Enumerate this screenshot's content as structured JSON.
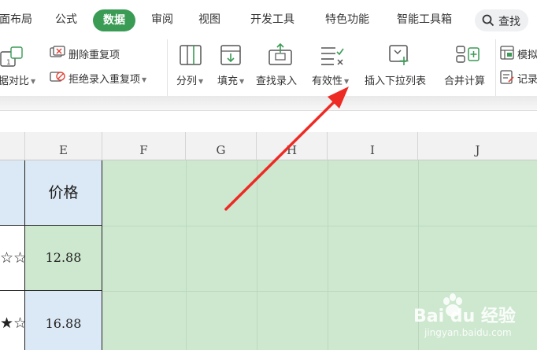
{
  "menu": {
    "items": [
      "面布局",
      "公式",
      "数据",
      "审阅",
      "视图",
      "开发工具",
      "特色功能",
      "智能工具箱"
    ],
    "active": "数据",
    "search_label": "查找"
  },
  "ribbon": {
    "compare_label": "据对比",
    "remove_dup_label": "删除重复项",
    "reject_dup_label": "拒绝录入重复项",
    "split_label": "分列",
    "fill_label": "填充",
    "lookup_label": "查找录入",
    "validity_label": "有效性",
    "dropdown_label": "插入下拉列表",
    "consolidate_label": "合并计算",
    "simulate_label": "模拟",
    "record_label": "记录"
  },
  "sheet": {
    "columns": [
      "E",
      "F",
      "G",
      "H",
      "I",
      "J"
    ],
    "header_cell": "价格",
    "rows": [
      {
        "stars": "☆☆",
        "price": "12.88"
      },
      {
        "stars": "★☆",
        "price": "16.88"
      }
    ]
  },
  "watermark": {
    "brand": "Bai du 经验",
    "url": "jingyan.baidu.com"
  },
  "colors": {
    "accent_green": "#3a9b55",
    "selection_fill": "#cde8cf",
    "header_fill": "#dbe8f5",
    "arrow": "#ee2a24"
  }
}
